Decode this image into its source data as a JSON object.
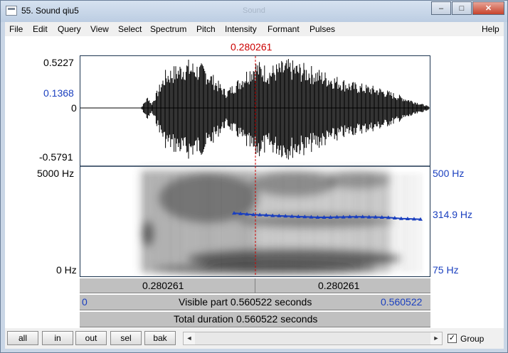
{
  "window": {
    "title": "55. Sound qiu5",
    "background_title": "Sound",
    "minimize": "–",
    "maximize": "□",
    "close": "✕"
  },
  "menu": [
    "File",
    "Edit",
    "Query",
    "View",
    "Select",
    "Spectrum",
    "Pitch",
    "Intensity",
    "Formant",
    "Pulses",
    "Help"
  ],
  "cursor": {
    "time": "0.280261",
    "color": "#cc0000"
  },
  "waveform": {
    "ymax": "0.5227",
    "cursor_value": "0.1368",
    "zero": "0",
    "ymin": "-0.5791"
  },
  "spectrogram": {
    "fmax": "5000 Hz",
    "fmin": "0 Hz"
  },
  "pitch": {
    "max": "500 Hz",
    "current": "314.9 Hz",
    "min": "75 Hz",
    "color": "#1a3fbf",
    "track_hz": [
      322,
      320,
      318,
      316,
      315,
      314,
      312,
      311,
      310,
      309,
      308,
      307,
      306,
      305,
      305,
      305,
      306,
      306,
      307,
      307,
      307,
      306,
      306,
      305,
      304,
      302,
      300,
      299,
      298,
      297
    ]
  },
  "time_bars": {
    "left_segment": "0.280261",
    "right_segment": "0.280261",
    "visible_start": "0",
    "visible_part": "Visible part 0.560522 seconds",
    "visible_end": "0.560522",
    "total_duration": "Total duration 0.560522 seconds"
  },
  "bottom": {
    "buttons": [
      "all",
      "in",
      "out",
      "sel",
      "bak"
    ],
    "scroll_left": "◄",
    "scroll_right": "►",
    "group_checked": "✓",
    "group_label": "Group"
  }
}
